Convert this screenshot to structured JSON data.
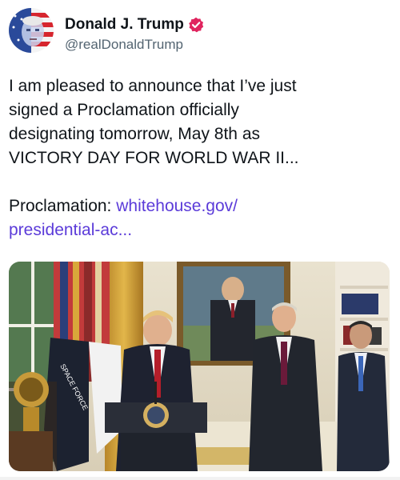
{
  "author": {
    "display_name": "Donald J. Trump",
    "handle": "@realDonaldTrump",
    "verified_color": "#e0245e"
  },
  "post": {
    "line1": "I am pleased to announce that I’ve just",
    "line2": "signed a Proclamation officially",
    "line3": "designating tomorrow, May 8th as",
    "line4": "VICTORY DAY FOR WORLD WAR II...",
    "link_prefix": "Proclamation: ",
    "link_line1": "whitehouse.gov/",
    "link_line2": "presidential-ac...",
    "link_color": "#5b3bd9"
  },
  "media": {
    "flag_text": "SPACE FORCE"
  }
}
